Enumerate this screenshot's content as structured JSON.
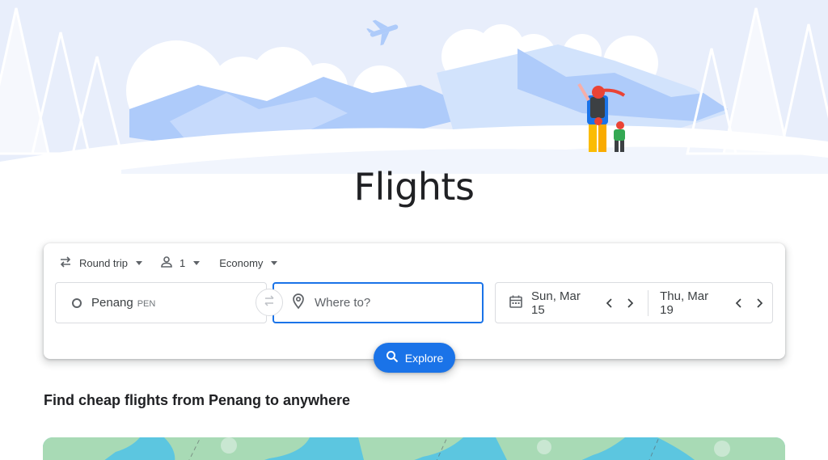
{
  "page": {
    "title": "Flights",
    "section_heading": "Find cheap flights from Penang to anywhere"
  },
  "search": {
    "trip_type": "Round trip",
    "passengers": "1",
    "cabin_class": "Economy",
    "origin": {
      "city": "Penang",
      "code": "PEN"
    },
    "destination": {
      "placeholder": "Where to?"
    },
    "departure": "Sun, Mar 15",
    "return": "Thu, Mar 19",
    "explore_label": "Explore"
  },
  "icons": {
    "trip_type": "swap-arrows-icon",
    "passengers": "person-icon",
    "origin": "circle-icon",
    "destination": "location-pin-icon",
    "swap": "swap-icon",
    "calendar": "calendar-icon",
    "prev": "chevron-left-icon",
    "next": "chevron-right-icon",
    "explore": "search-icon"
  },
  "colors": {
    "accent": "#1a73e8",
    "hero_sky": "#e8eefb",
    "hero_mountain": "#aecbfa",
    "map_land": "#a8dab5",
    "map_water": "#5cc6e0"
  }
}
